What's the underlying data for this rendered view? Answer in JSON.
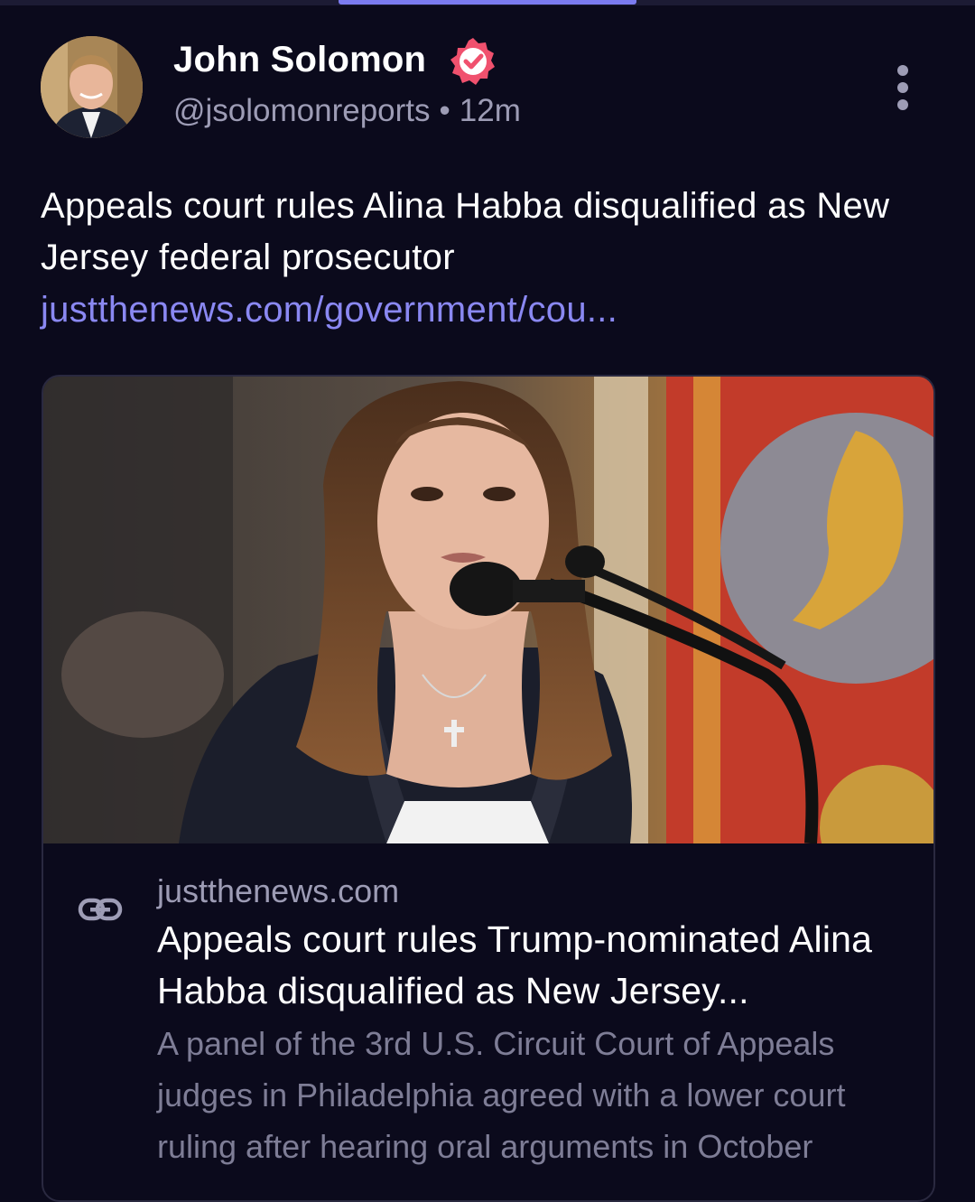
{
  "post": {
    "author": {
      "name": "John Solomon",
      "handle": "@jsolomonreports",
      "separator": "•",
      "time": "12m",
      "verified": true,
      "avatar_icon": "profile-photo"
    },
    "text": "Appeals court rules Alina Habba disqualified as New Jersey federal prosecutor",
    "link_text": "justthenews.com/government/cou...",
    "more_icon": "vertical-ellipsis-icon"
  },
  "link_card": {
    "domain": "justthenews.com",
    "title": "Appeals court rules Trump-nominated Alina Habba disqualified as New Jersey...",
    "description": "A panel of the 3rd U.S. Circuit Court of Appeals judges in Philadelphia agreed with a lower court ruling after hearing oral arguments in October",
    "link_icon": "link-chain-icon",
    "image_icon": "article-photo"
  },
  "colors": {
    "background": "#0b0a1c",
    "link": "#8a88f2",
    "verified_badge": "#f0516e",
    "muted_text": "#9d9cb5",
    "tab_indicator": "#7b7bf0"
  }
}
